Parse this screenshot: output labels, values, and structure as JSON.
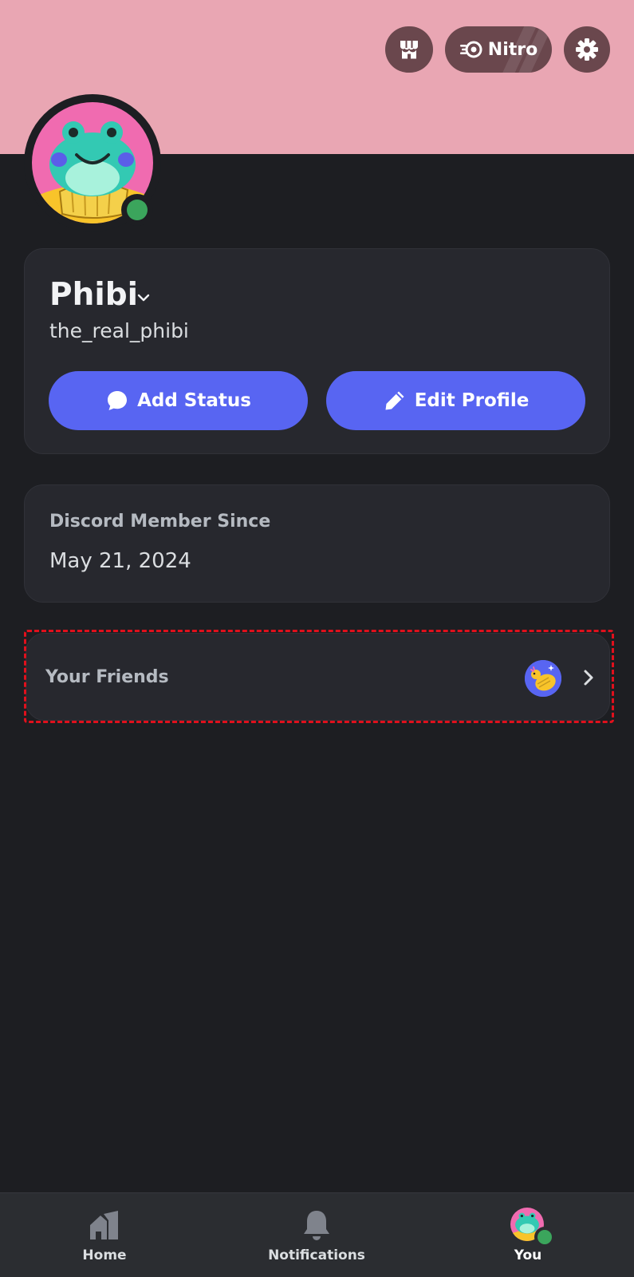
{
  "header": {
    "nitro_label": "Nitro",
    "banner_color": "#e9a6b3",
    "icons": [
      "shop-icon",
      "nitro-icon",
      "gear-icon"
    ]
  },
  "profile": {
    "display_name": "Phibi",
    "username": "the_real_phibi",
    "status": "online",
    "status_color": "#3ba55c",
    "add_status_label": "Add Status",
    "edit_profile_label": "Edit Profile",
    "button_color": "#5865f2"
  },
  "member": {
    "label": "Discord Member Since",
    "date": "May 21, 2024"
  },
  "friends": {
    "label": "Your Friends"
  },
  "bottom_nav": {
    "home_label": "Home",
    "notifications_label": "Notifications",
    "you_label": "You"
  }
}
